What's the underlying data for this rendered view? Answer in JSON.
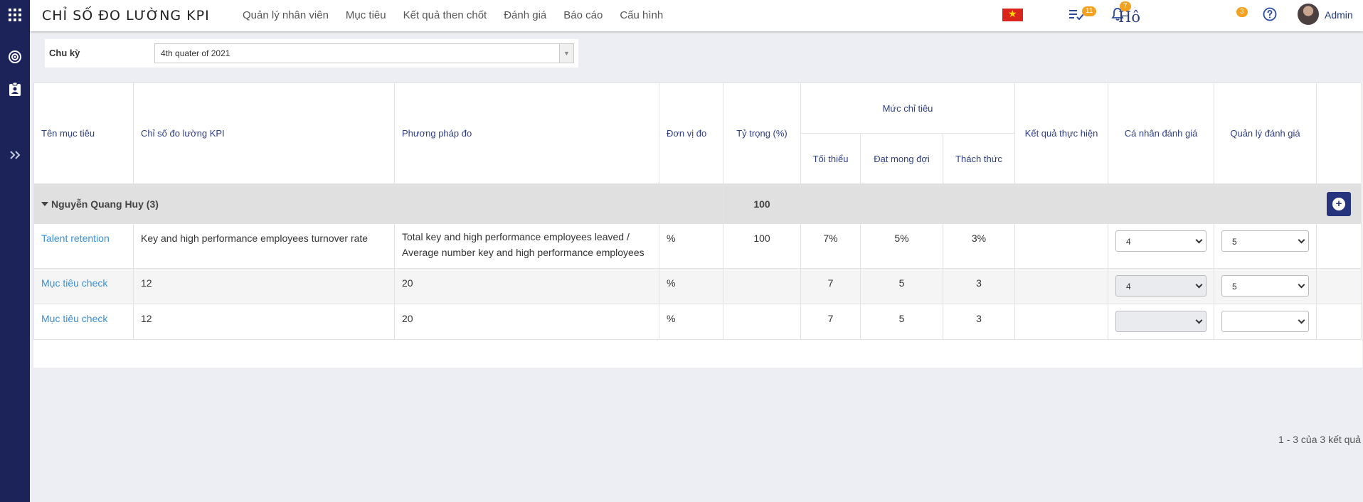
{
  "app": {
    "title": "CHỈ SỐ ĐO LƯỜNG KPI"
  },
  "nav": [
    "Quản lý nhân viên",
    "Mục tiêu",
    "Kết quả then chốt",
    "Đánh giá",
    "Báo cáo",
    "Cấu hình"
  ],
  "header_right": {
    "tasks_badge": "11",
    "notif_badge": "7",
    "hoval_text": "Hô",
    "ext_badge": "3",
    "user_name": "Admin"
  },
  "filter": {
    "label": "Chu kỳ",
    "value": "4th quater of 2021"
  },
  "table": {
    "headers": {
      "goal": "Tên mục tiêu",
      "kpi": "Chỉ số đo lường KPI",
      "method": "Phương pháp đo",
      "unit": "Đơn vị đo",
      "weight": "Tỷ trọng (%)",
      "target_group": "Mức chỉ tiêu",
      "min": "Tối thiểu",
      "expected": "Đạt mong đợi",
      "challenge": "Thách thức",
      "result": "Kết quả thực hiện",
      "self_eval": "Cá nhân đánh giá",
      "mgr_eval": "Quản lý đánh giá"
    },
    "group": {
      "name": "Nguyễn Quang Huy (3)",
      "weight": "100"
    },
    "rows": [
      {
        "goal": "Talent retention",
        "kpi": "Key and high performance employees turnover rate",
        "method": "Total key and high performance employees leaved / Average number key and high performance employees",
        "unit": "%",
        "weight": "100",
        "min": "7%",
        "expected": "5%",
        "challenge": "3%",
        "result": "",
        "self_eval": "4",
        "mgr_eval": "5"
      },
      {
        "goal": "Mục tiêu check",
        "kpi": "12",
        "method": "20",
        "unit": "%",
        "weight": "",
        "min": "7",
        "expected": "5",
        "challenge": "3",
        "result": "",
        "self_eval": "4",
        "mgr_eval": "5"
      },
      {
        "goal": "Mục tiêu check",
        "kpi": "12",
        "method": "20",
        "unit": "%",
        "weight": "",
        "min": "7",
        "expected": "5",
        "challenge": "3",
        "result": "",
        "self_eval": "",
        "mgr_eval": ""
      }
    ]
  },
  "pagination": {
    "summary": "1 - 3 của 3 kết quả"
  }
}
